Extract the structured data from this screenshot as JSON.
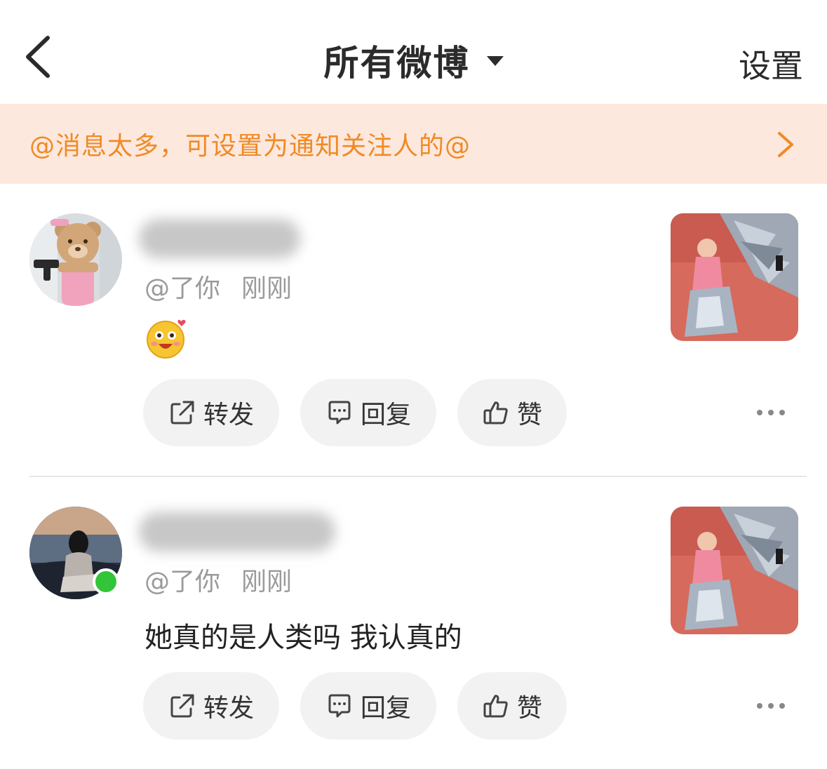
{
  "header": {
    "title": "所有微博",
    "settings_label": "设置"
  },
  "banner": {
    "text": "@消息太多，可设置为通知关注人的@"
  },
  "posts": [
    {
      "handle": "@了你",
      "time": "刚刚",
      "text": "",
      "online": false,
      "actions": {
        "forward": "转发",
        "reply": "回复",
        "like": "赞"
      }
    },
    {
      "handle": "@了你",
      "time": "刚刚",
      "text": "她真的是人类吗 我认真的",
      "online": true,
      "actions": {
        "forward": "转发",
        "reply": "回复",
        "like": "赞"
      }
    }
  ],
  "colors": {
    "accent_orange": "#f08a25",
    "banner_bg": "#fde8de",
    "online_green": "#32c53a"
  }
}
